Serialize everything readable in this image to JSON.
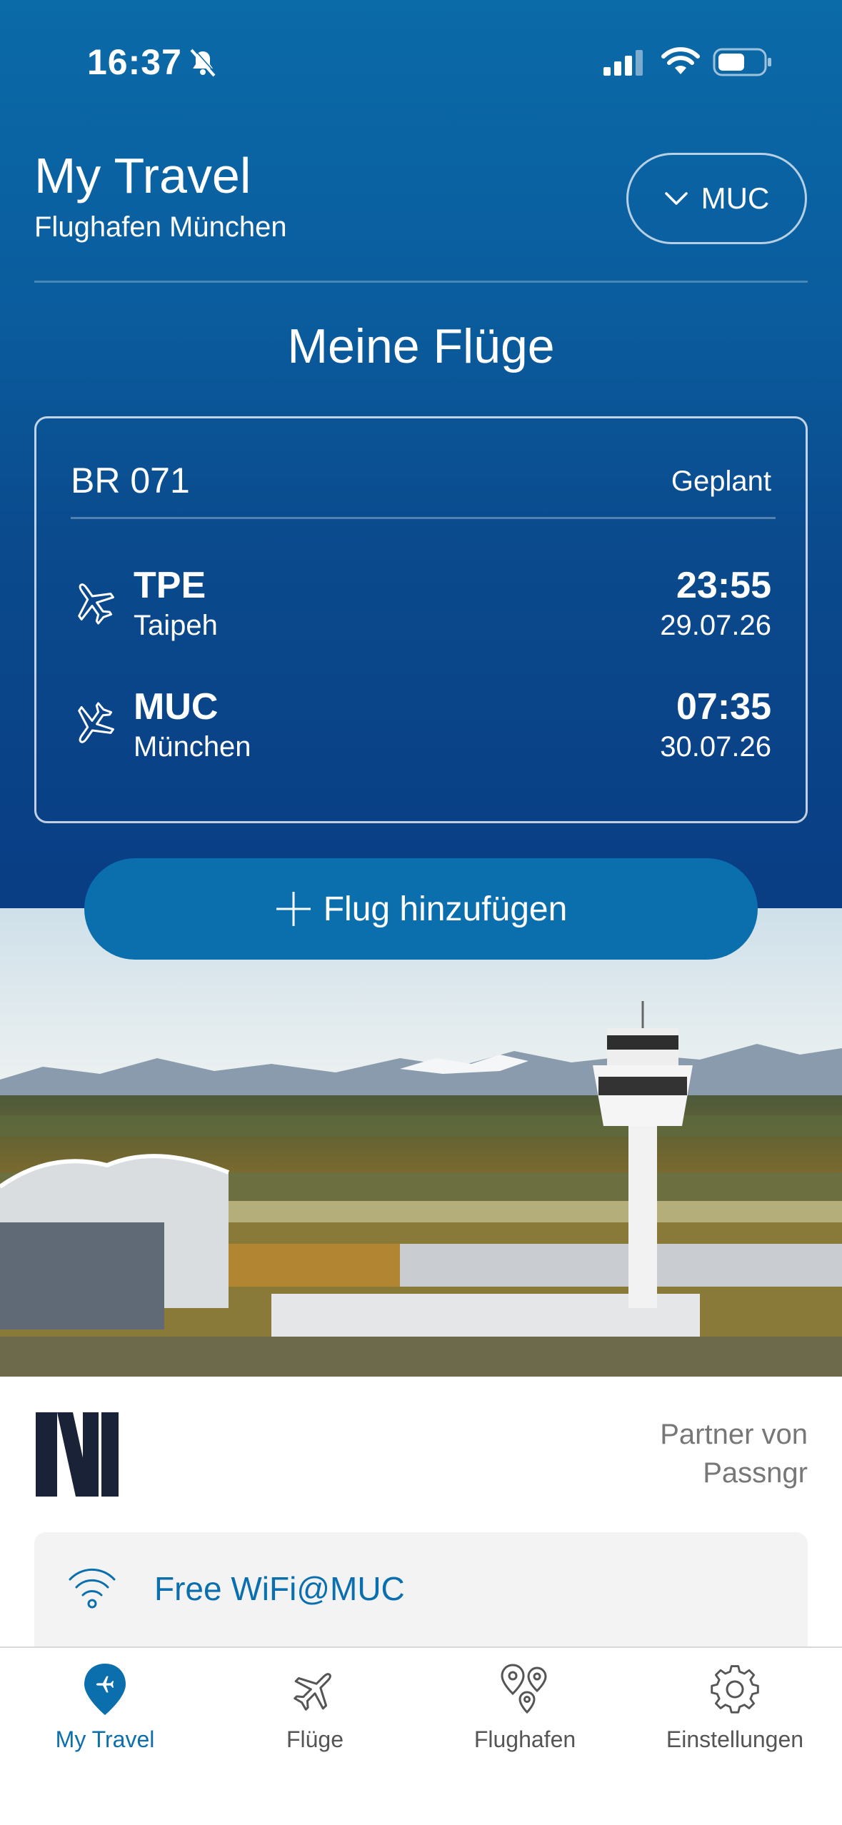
{
  "status_bar": {
    "time": "16:37"
  },
  "header": {
    "title": "My Travel",
    "subtitle": "Flughafen München",
    "airport_selector": "MUC"
  },
  "section_title": "Meine Flüge",
  "flight": {
    "number": "BR 071",
    "status": "Geplant",
    "departure": {
      "code": "TPE",
      "city": "Taipeh",
      "time": "23:55",
      "date": "29.07.26"
    },
    "arrival": {
      "code": "MUC",
      "city": "München",
      "time": "07:35",
      "date": "30.07.26"
    }
  },
  "add_flight_label": "Flug hinzufügen",
  "partner": {
    "line1": "Partner von",
    "line2": "Passngr"
  },
  "wifi_label": "Free WiFi@MUC",
  "tabs": [
    {
      "label": "My Travel",
      "icon": "location-plane-icon",
      "active": true
    },
    {
      "label": "Flüge",
      "icon": "plane-icon",
      "active": false
    },
    {
      "label": "Flughafen",
      "icon": "map-pins-icon",
      "active": false
    },
    {
      "label": "Einstellungen",
      "icon": "gear-icon",
      "active": false
    }
  ],
  "colors": {
    "primary": "#0b6fae",
    "header_dark": "#093d84",
    "text_muted": "#777777"
  }
}
